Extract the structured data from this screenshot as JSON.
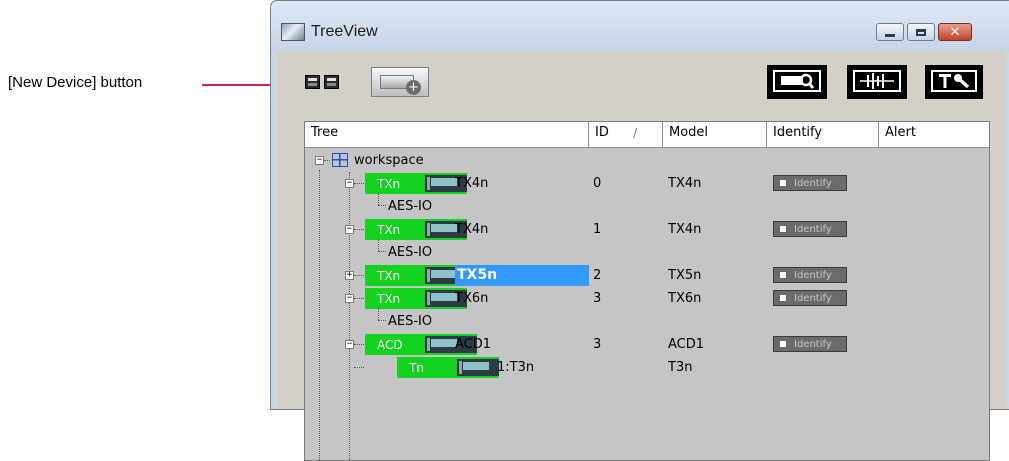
{
  "callout": {
    "label": "[New Device] button"
  },
  "window": {
    "title": "TreeView",
    "minimize_icon": "minimize-icon",
    "maximize_icon": "maximize-icon",
    "close_icon": "close-icon",
    "close_glyph": "✕"
  },
  "toolbar": {
    "new_device_plus": "+",
    "tool_buttons": [
      {
        "icon": "device-search-icon",
        "glyph": "🔍"
      },
      {
        "icon": "waveform-icon",
        "glyph": "╫╫╫"
      },
      {
        "icon": "tools-icon",
        "glyph": "T🔧"
      }
    ]
  },
  "grid": {
    "columns": {
      "tree": "Tree",
      "id": "ID",
      "model": "Model",
      "identify": "Identify",
      "alert": "Alert"
    },
    "sort_glyph": "/",
    "workspace_label": "workspace",
    "identify_label": "Identify",
    "rows": [
      {
        "badge": "TXn",
        "name": "TX4n",
        "id": "0",
        "model": "TX4n",
        "child": "AES-IO"
      },
      {
        "badge": "TXn",
        "name": "TX4n",
        "id": "1",
        "model": "TX4n",
        "child": "AES-IO"
      },
      {
        "badge": "TXn",
        "name": "TX5n",
        "id": "2",
        "model": "TX5n",
        "selected": true,
        "collapsed": true
      },
      {
        "badge": "TXn",
        "name": "TX6n",
        "id": "3",
        "model": "TX6n",
        "child": "AES-IO"
      },
      {
        "badge": "ACD",
        "name": "ACD1",
        "id": "3",
        "model": "ACD1"
      },
      {
        "badge": "Tn",
        "name": "1:T3n",
        "id": "",
        "model": "T3n"
      }
    ]
  },
  "colors": {
    "accent_green": "#13d31f",
    "selection_blue": "#3399ff",
    "callout_red": "#d1235a"
  }
}
